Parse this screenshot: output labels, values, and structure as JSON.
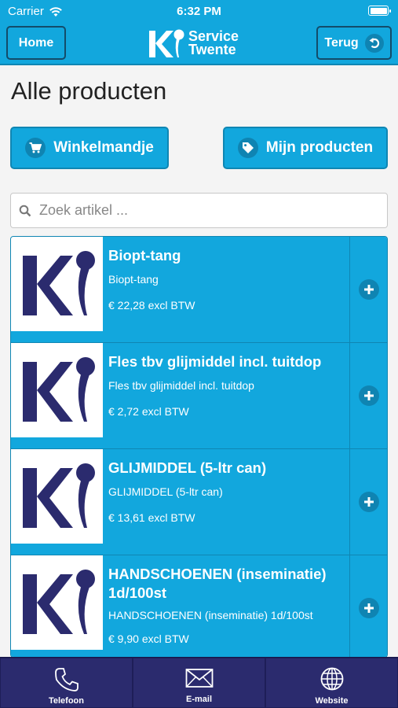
{
  "status": {
    "carrier": "Carrier",
    "time": "6:32 PM"
  },
  "header": {
    "home_label": "Home",
    "back_label": "Terug",
    "logo_text_line1": "Service",
    "logo_text_line2": "Twente",
    "brand_color": "#12a7dd",
    "logo_color": "#2b2b6e"
  },
  "page": {
    "title": "Alle producten"
  },
  "actions": {
    "cart_label": "Winkelmandje",
    "my_products_label": "Mijn producten"
  },
  "search": {
    "placeholder": "Zoek artikel ...",
    "value": ""
  },
  "products": [
    {
      "title": "Biopt-tang",
      "description": "Biopt-tang",
      "price": "€ 22,28 excl BTW"
    },
    {
      "title": "Fles tbv glijmiddel incl. tuitdop",
      "description": "Fles tbv glijmiddel incl. tuitdop",
      "price": "€ 2,72 excl BTW"
    },
    {
      "title": "GLIJMIDDEL (5-ltr can)",
      "description": "GLIJMIDDEL (5-ltr can)",
      "price": "€ 13,61 excl BTW"
    },
    {
      "title": "HANDSCHOENEN (inseminatie) 1d/100st",
      "description": "HANDSCHOENEN (inseminatie) 1d/100st",
      "price": "€ 9,90 excl BTW"
    }
  ],
  "tabbar": {
    "phone_label": "Telefoon",
    "email_label": "E-mail",
    "website_label": "Website"
  }
}
